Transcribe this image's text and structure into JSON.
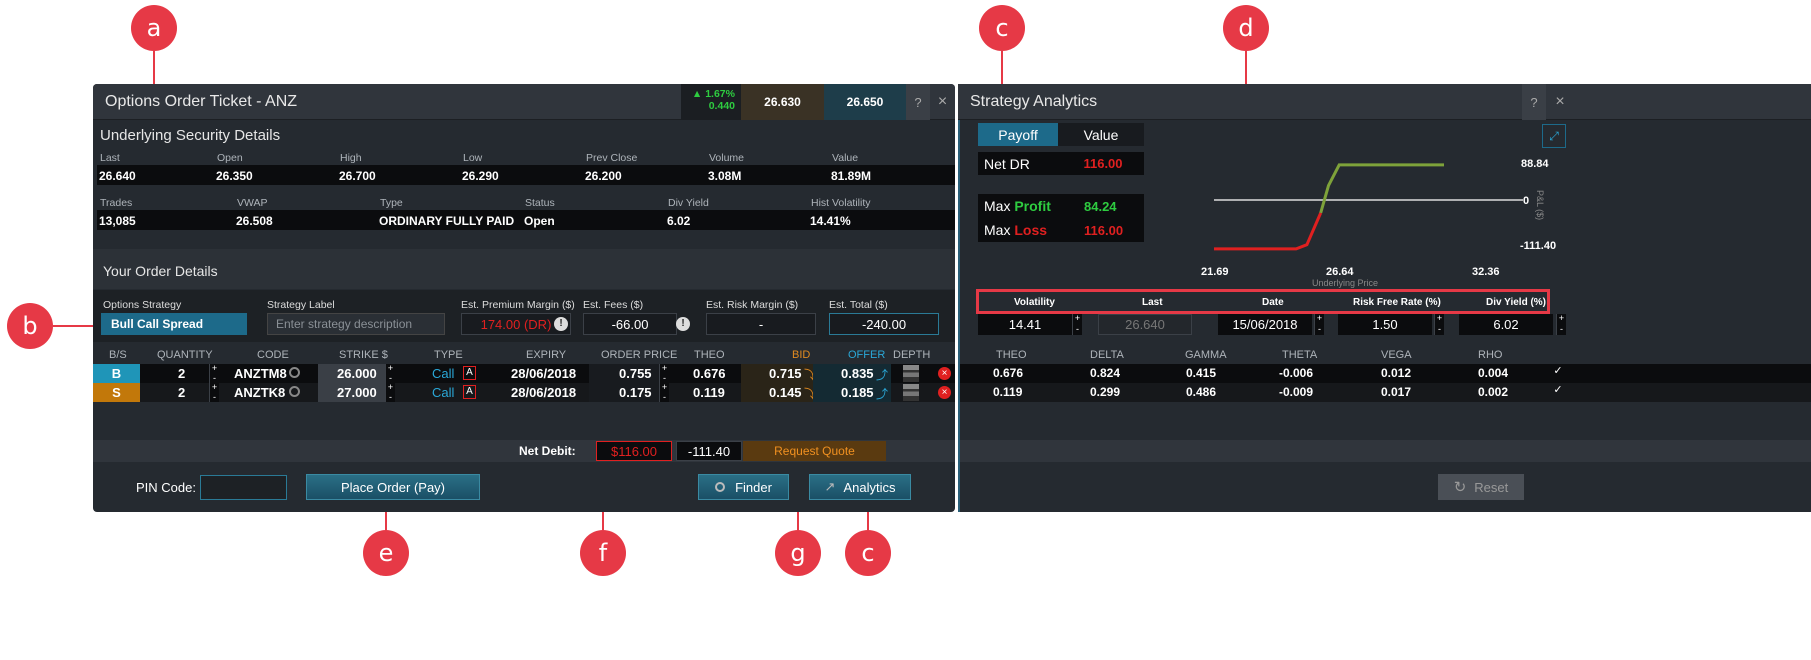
{
  "callouts": {
    "a": "a",
    "b": "b",
    "c1": "c",
    "d": "d",
    "e": "e",
    "f": "f",
    "g": "g",
    "c2": "c"
  },
  "ticket": {
    "title": "Options Order Ticket - ANZ",
    "change_pct": "▲ 1.67%",
    "change_abs": "0.440",
    "bid": "26.630",
    "ask": "26.650",
    "help": "?",
    "close": "×",
    "underlying_title": "Underlying Security Details",
    "row1_labels": [
      "Last",
      "Open",
      "High",
      "Low",
      "Prev Close",
      "Volume",
      "Value"
    ],
    "row1_values": [
      "26.640",
      "26.350",
      "26.700",
      "26.290",
      "26.200",
      "3.08M",
      "81.89M"
    ],
    "row2_labels": [
      "Trades",
      "VWAP",
      "Type",
      "Status",
      "Div Yield",
      "Hist Volatility"
    ],
    "row2_values": [
      "13,085",
      "26.508",
      "ORDINARY FULLY PAID",
      "Open",
      "6.02",
      "14.41%"
    ],
    "order_title": "Your Order Details",
    "strategy_label": "Options Strategy",
    "strategy_value": "Bull Call Spread",
    "label_label": "Strategy Label",
    "label_placeholder": "Enter strategy description",
    "prem_label": "Est. Premium Margin ($)",
    "prem_value": "174.00 (DR)",
    "fees_label": "Est. Fees ($)",
    "fees_value": "-66.00",
    "risk_label": "Est. Risk Margin ($)",
    "risk_value": "-",
    "total_label": "Est. Total ($)",
    "total_value": "-240.00",
    "columns": [
      "B/S",
      "QUANTITY",
      "CODE",
      "STRIKE $",
      "TYPE",
      "EXPIRY",
      "ORDER PRICE",
      "THEO",
      "BID",
      "OFFER",
      "DEPTH"
    ],
    "legs": [
      {
        "side": "B",
        "qty": "2",
        "code": "ANZTM8",
        "strike": "26.000",
        "type": "Call",
        "expiry": "28/06/2018",
        "price": "0.755",
        "theo": "0.676",
        "bid": "0.715",
        "offer": "0.835"
      },
      {
        "side": "S",
        "qty": "2",
        "code": "ANZTK8",
        "strike": "27.000",
        "type": "Call",
        "expiry": "28/06/2018",
        "price": "0.175",
        "theo": "0.119",
        "bid": "0.145",
        "offer": "0.185"
      }
    ],
    "type_badge": "A",
    "net_debit_label": "Net Debit:",
    "net_debit_value": "$116.00",
    "net_debit_pl": "-111.40",
    "request_quote": "Request Quote",
    "pin_label": "PIN Code:",
    "place_order": "Place Order (Pay)",
    "finder": "Finder",
    "analytics": "Analytics"
  },
  "analytics": {
    "title": "Strategy Analytics",
    "help": "?",
    "close": "×",
    "tab_payoff": "Payoff",
    "tab_value": "Value",
    "net_label": "Net DR",
    "net_value": "116.00",
    "max1": "Max",
    "profit": "Profit",
    "profit_value": "84.24",
    "max2": "Max",
    "loss": "Loss",
    "loss_value": "116.00",
    "y_top": "88.84",
    "y_zero": "0",
    "y_bottom": "-111.40",
    "y_axis": "P&L ($)",
    "x_left": "21.69",
    "x_mid": "26.64",
    "x_right": "32.36",
    "x_axis": "Underlying Price",
    "param_labels": [
      "Volatility",
      "Last",
      "Date",
      "Risk Free Rate (%)",
      "Div Yield (%)"
    ],
    "param_values": [
      "14.41",
      "26.640",
      "15/06/2018",
      "1.50",
      "6.02"
    ],
    "greek_cols": [
      "THEO",
      "DELTA",
      "GAMMA",
      "THETA",
      "VEGA",
      "RHO"
    ],
    "greeks": [
      [
        "0.676",
        "0.824",
        "0.415",
        "-0.006",
        "0.012",
        "0.004"
      ],
      [
        "0.119",
        "0.299",
        "0.486",
        "-0.009",
        "0.017",
        "0.002"
      ]
    ],
    "reset": "Reset"
  },
  "chart_data": {
    "type": "line",
    "xlabel": "Underlying Price",
    "ylabel": "P&L ($)",
    "xlim": [
      21.69,
      32.36
    ],
    "ylim": [
      -111.4,
      88.84
    ],
    "series": [
      {
        "x": [
          21.69,
          25.5,
          26.0,
          26.64,
          27.0,
          27.5,
          32.36
        ],
        "values": [
          -116,
          -116,
          -106,
          -30,
          35,
          84.24,
          84.24
        ]
      }
    ]
  }
}
